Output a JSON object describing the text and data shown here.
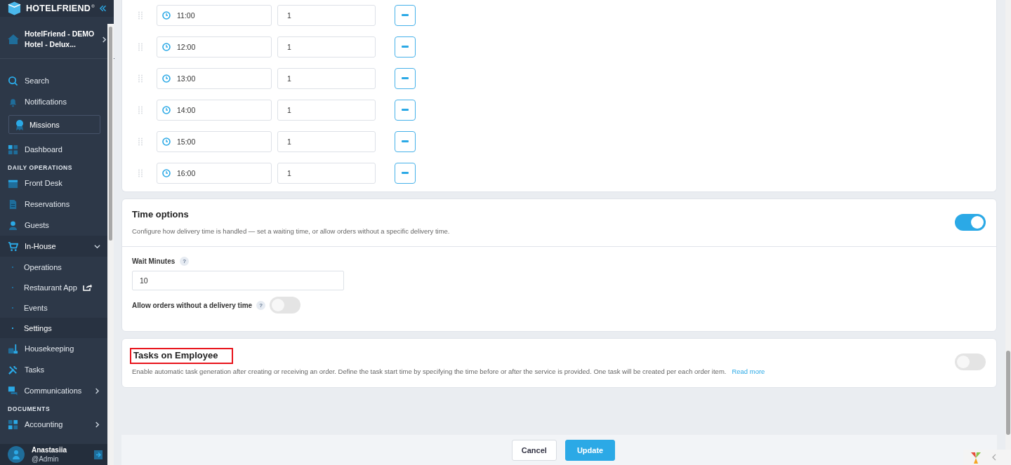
{
  "brand": {
    "name": "HOTELFRIEND",
    "mark": "®"
  },
  "hotel": {
    "line1": "HotelFriend - DEMO",
    "line2": "Hotel - Delux..."
  },
  "nav_top": [
    {
      "label": "Search"
    },
    {
      "label": "Notifications"
    }
  ],
  "missions": {
    "label": "Missions"
  },
  "nav": [
    {
      "kind": "item",
      "label": "Dashboard",
      "expanded": false,
      "has_children": false
    },
    {
      "kind": "section",
      "label": "DAILY OPERATIONS"
    },
    {
      "kind": "item",
      "label": "Front Desk",
      "expanded": false,
      "has_children": false
    },
    {
      "kind": "item",
      "label": "Reservations",
      "expanded": false,
      "has_children": false
    },
    {
      "kind": "item",
      "label": "Guests",
      "expanded": false,
      "has_children": false
    },
    {
      "kind": "item",
      "label": "In-House",
      "expanded": true,
      "has_children": true,
      "children": [
        {
          "label": "Operations",
          "selected": false,
          "external": false
        },
        {
          "label": "Restaurant App",
          "selected": false,
          "external": true
        },
        {
          "label": "Events",
          "selected": false,
          "external": false
        },
        {
          "label": "Settings",
          "selected": true,
          "external": false
        }
      ]
    },
    {
      "kind": "item",
      "label": "Housekeeping",
      "expanded": false,
      "has_children": false
    },
    {
      "kind": "item",
      "label": "Tasks",
      "expanded": false,
      "has_children": false
    },
    {
      "kind": "item",
      "label": "Communications",
      "expanded": false,
      "has_children": true
    },
    {
      "kind": "section",
      "label": "DOCUMENTS"
    },
    {
      "kind": "item",
      "label": "Accounting",
      "expanded": false,
      "has_children": true
    }
  ],
  "user": {
    "name": "Anastasiia",
    "role": "@Admin"
  },
  "time_slots": [
    {
      "time": "11:00",
      "quantity": "1"
    },
    {
      "time": "12:00",
      "quantity": "1"
    },
    {
      "time": "13:00",
      "quantity": "1"
    },
    {
      "time": "14:00",
      "quantity": "1"
    },
    {
      "time": "15:00",
      "quantity": "1"
    },
    {
      "time": "16:00",
      "quantity": "1"
    }
  ],
  "time_options": {
    "title": "Time options",
    "description": "Configure how delivery time is handled — set a waiting time, or allow orders without a specific delivery time.",
    "on": true,
    "wait_label": "Wait Minutes",
    "wait_help": "?",
    "wait_value": "10",
    "allow_label": "Allow orders without a delivery time",
    "allow_help": "?",
    "allow_on": false
  },
  "tasks": {
    "title": "Tasks on Employee",
    "description": "Enable automatic task generation after creating or receiving an order. Define the task start time by specifying the time before or after the service is provided. One task will be created per each order item.",
    "link": "Read more",
    "on": false,
    "highlighted": true
  },
  "buttons": {
    "cancel": "Cancel",
    "update": "Update"
  }
}
